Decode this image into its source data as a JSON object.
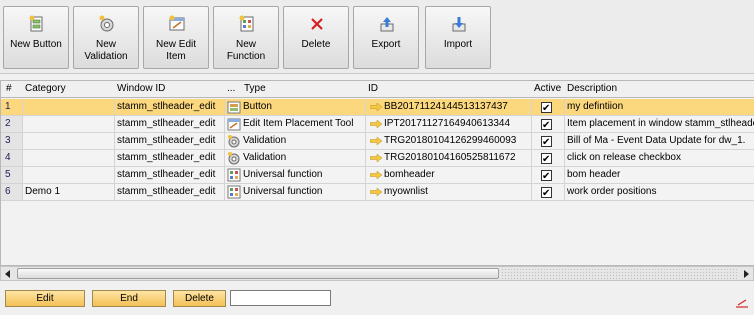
{
  "toolbar": {
    "buttons": [
      {
        "label": "New Button",
        "icon": "new-button-icon"
      },
      {
        "label": "New Validation",
        "icon": "new-validation-icon"
      },
      {
        "label": "New Edit Item",
        "icon": "new-edit-item-icon"
      },
      {
        "label": "New Function",
        "icon": "new-function-icon"
      },
      {
        "label": "Delete",
        "icon": "delete-icon"
      },
      {
        "label": "Export",
        "icon": "export-icon"
      },
      {
        "label": "Import",
        "icon": "import-icon"
      }
    ]
  },
  "grid": {
    "columns": [
      "#",
      "Category",
      "Window ID",
      "...",
      "Type",
      "ID",
      "Active",
      "Description"
    ],
    "rows": [
      {
        "num": "1",
        "category": "",
        "window_id": "stamm_stlheader_edit",
        "type": "Button",
        "type_icon": "button-icon",
        "id": "BB20171124144513137437",
        "active": true,
        "description": "my defintiion",
        "selected": true
      },
      {
        "num": "2",
        "category": "",
        "window_id": "stamm_stlheader_edit",
        "type": "Edit Item Placement Tool",
        "type_icon": "edit-item-icon",
        "id": "IPT20171127164940613344",
        "active": true,
        "description": "Item placement in window stamm_stlheader_e",
        "selected": false
      },
      {
        "num": "3",
        "category": "",
        "window_id": "stamm_stlheader_edit",
        "type": "Validation",
        "type_icon": "validation-icon",
        "id": "TRG20180104126299460093",
        "active": true,
        "description": "Bill of Ma - Event Data Update for dw_1.",
        "selected": false
      },
      {
        "num": "4",
        "category": "",
        "window_id": "stamm_stlheader_edit",
        "type": "Validation",
        "type_icon": "validation-icon",
        "id": "TRG20180104160525811672",
        "active": true,
        "description": "click on release checkbox",
        "selected": false
      },
      {
        "num": "5",
        "category": "",
        "window_id": "stamm_stlheader_edit",
        "type": "Universal function",
        "type_icon": "function-icon",
        "id": "bomheader",
        "active": true,
        "description": "bom header",
        "selected": false
      },
      {
        "num": "6",
        "category": "Demo 1",
        "window_id": "stamm_stlheader_edit",
        "type": "Universal function",
        "type_icon": "function-icon",
        "id": "myownlist",
        "active": true,
        "description": "work order positions",
        "selected": false
      }
    ]
  },
  "bottom": {
    "edit_label": "Edit",
    "end_label": "End",
    "delete_label": "Delete",
    "field_value": ""
  },
  "colors": {
    "selected_row": "#fbd77e",
    "accent_button": "#f4c055",
    "id_arrow": "#f5c842"
  }
}
